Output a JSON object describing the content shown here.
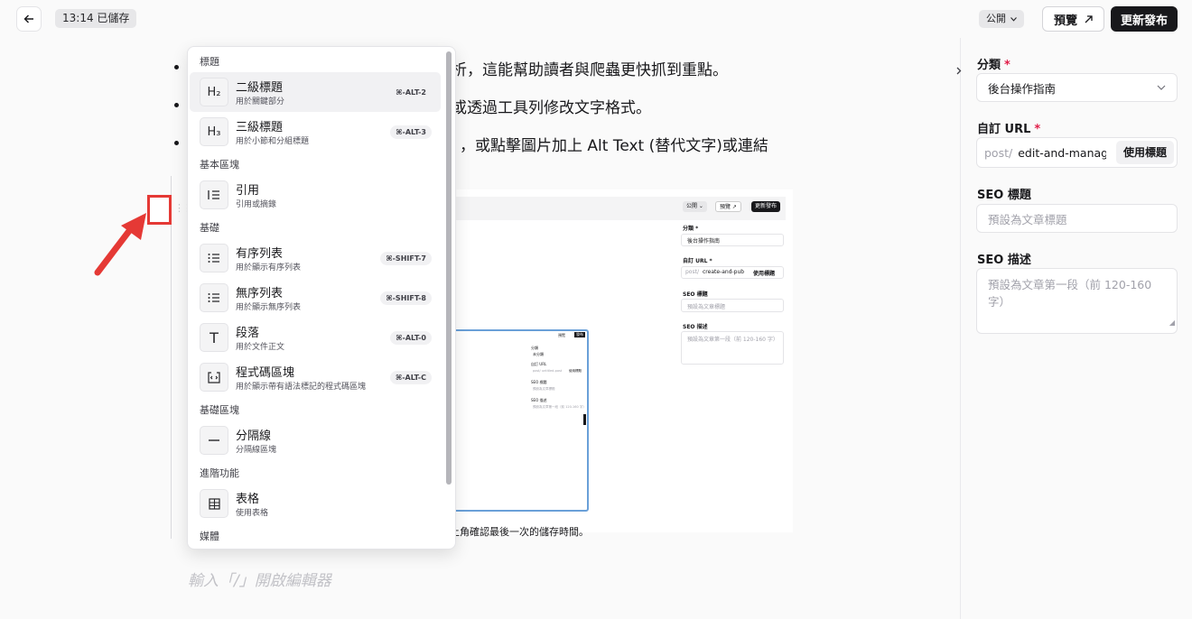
{
  "topbar": {
    "save_status": "13:14 已儲存",
    "visibility": "公開",
    "preview_label": "預覽",
    "publish_label": "更新發布"
  },
  "editor": {
    "lines": [
      "析，這能幫助讀者與爬蟲更快抓到重點。",
      "或透過工具列修改文字格式。",
      "，或點擊圖片加上 Alt Text (替代文字)或連結"
    ],
    "caption": "上角確認最後一次的儲存時間。",
    "placeholder": "輸入「/」開啟編輯器"
  },
  "embedded_screenshot": {
    "visibility": "公開",
    "preview": "預覽",
    "publish": "更新發布",
    "category_label": "分類 *",
    "category_value": "後台操作指南",
    "url_label": "自訂 URL *",
    "url_prefix": "post/",
    "url_value": "create-and-pub",
    "url_button": "使用標題",
    "seo_title_label": "SEO 標題",
    "seo_title_placeholder": "預設為文章標題",
    "seo_desc_label": "SEO 描述",
    "seo_desc_placeholder": "預設為文章第一段（前 120-160 字）",
    "inner": {
      "preview": "預覽",
      "publish": "發布",
      "category_label": "分類",
      "category_value": "未分類",
      "url_label": "自訂 URL",
      "url_value": "post/ untitled-post",
      "url_button": "使用標題",
      "seo_title_label": "SEO 標題",
      "seo_title_placeholder": "預設為文章標題",
      "seo_desc_label": "SEO 描述",
      "seo_desc_placeholder": "預設為文章第一段（前 120-160 字）"
    }
  },
  "slash_menu": {
    "sections": [
      {
        "label": "標題"
      },
      {
        "label": "基本區塊"
      },
      {
        "label": "基礎"
      },
      {
        "label": "基礎區塊"
      },
      {
        "label": "進階功能"
      },
      {
        "label": "媒體"
      }
    ],
    "items": [
      {
        "icon": "H₂",
        "title": "二級標題",
        "desc": "用於關鍵部分",
        "shortcut": "⌘-ALT-2"
      },
      {
        "icon": "H₃",
        "title": "三級標題",
        "desc": "用於小節和分組標題",
        "shortcut": "⌘-ALT-3"
      },
      {
        "icon": "quote",
        "title": "引用",
        "desc": "引用或摘錄",
        "shortcut": ""
      },
      {
        "icon": "ordered-list",
        "title": "有序列表",
        "desc": "用於顯示有序列表",
        "shortcut": "⌘-SHIFT-7"
      },
      {
        "icon": "bullet-list",
        "title": "無序列表",
        "desc": "用於顯示無序列表",
        "shortcut": "⌘-SHIFT-8"
      },
      {
        "icon": "T",
        "title": "段落",
        "desc": "用於文件正文",
        "shortcut": "⌘-ALT-0"
      },
      {
        "icon": "code",
        "title": "程式碼區塊",
        "desc": "用於顯示帶有語法標記的程式碼區塊",
        "shortcut": "⌘-ALT-C"
      },
      {
        "icon": "divider",
        "title": "分隔線",
        "desc": "分隔線區塊",
        "shortcut": ""
      },
      {
        "icon": "table",
        "title": "表格",
        "desc": "使用表格",
        "shortcut": ""
      }
    ]
  },
  "sidebar": {
    "category_label": "分類",
    "category_value": "後台操作指南",
    "url_label": "自訂 URL",
    "url_prefix": "post/",
    "url_value": "edit-and-manag",
    "url_button": "使用標題",
    "seo_title_label": "SEO 標題",
    "seo_title_placeholder": "預設為文章標題",
    "seo_desc_label": "SEO 描述",
    "seo_desc_placeholder": "預設為文章第一段（前 120-160 字）",
    "required_mark": "*"
  },
  "colors": {
    "accent": "#18181b",
    "annotation": "#e53935",
    "required": "#e11d48"
  }
}
